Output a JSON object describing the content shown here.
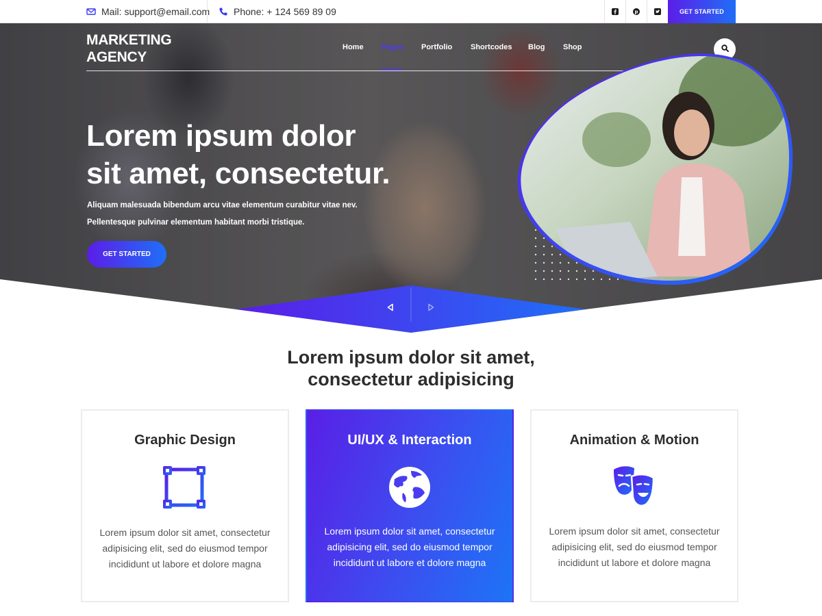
{
  "topbar": {
    "mail": "Mail: support@email.com",
    "phone": "Phone: + 124 569 89 09",
    "socials": [
      "facebook-icon",
      "pinterest-icon",
      "twitter-icon"
    ],
    "cta_label": "GET STARTED"
  },
  "header": {
    "logo_line1": "MARKETING",
    "logo_line2": "AGENCY",
    "nav": [
      "Home",
      "Pages",
      "Portfolio",
      "Shortcodes",
      "Blog",
      "Shop"
    ],
    "active_nav": "Pages"
  },
  "hero": {
    "title_line1": "Lorem ipsum dolor",
    "title_line2": "sit amet, consectetur.",
    "sub_line1": "Aliquam malesuada bibendum arcu vitae elementum curabitur vitae nev.",
    "sub_line2": "Pellentesque pulvinar elementum habitant morbi tristique.",
    "cta_label": "GET STARTED"
  },
  "section": {
    "title_line1": "Lorem ipsum dolor sit amet,",
    "title_line2": "consectetur adipisicing"
  },
  "cards": [
    {
      "title": "Graphic Design",
      "icon": "vector-square-icon",
      "desc": [
        "Lorem ipsum dolor sit amet, consectetur",
        "adipisicing elit, sed do eiusmod tempor",
        "incididunt ut labore et dolore magna"
      ]
    },
    {
      "title": "UI/UX & Interaction",
      "icon": "globe-icon",
      "desc": [
        "Lorem ipsum dolor sit amet, consectetur",
        "adipisicing elit, sed do eiusmod tempor",
        "incididunt ut labore et dolore magna"
      ]
    },
    {
      "title": "Animation & Motion",
      "icon": "theater-masks-icon",
      "desc": [
        "Lorem ipsum dolor sit amet, consectetur",
        "adipisicing elit, sed do eiusmod tempor",
        "incididunt ut labore et dolore magna"
      ]
    }
  ],
  "colors": {
    "accent_start": "#5b1de8",
    "accent_end": "#1f6ff7",
    "nav_active": "#4c3af0"
  }
}
